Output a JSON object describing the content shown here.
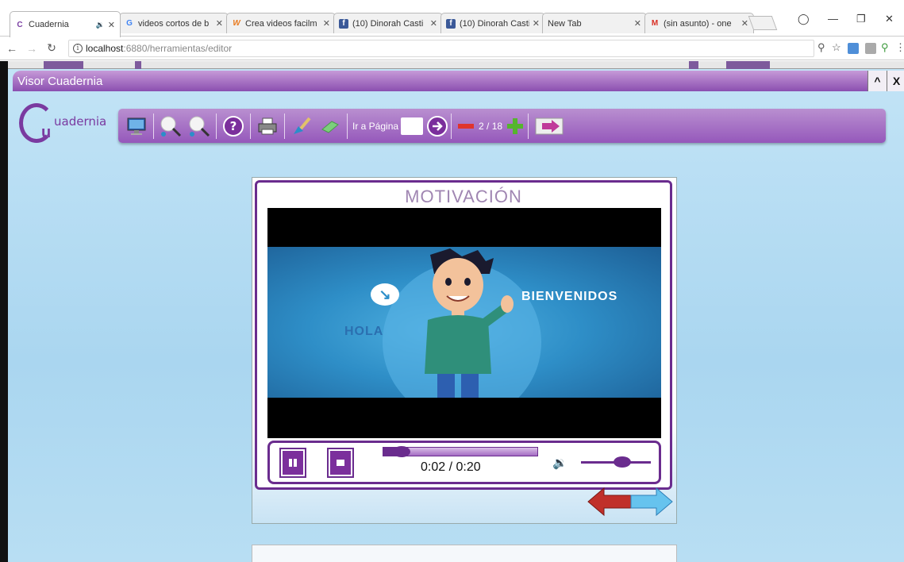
{
  "browser": {
    "tabs": [
      {
        "label": "Cuadernia",
        "icon": "cuadernia-icon",
        "audio": true,
        "active": true
      },
      {
        "label": "videos cortos de b",
        "icon": "google-icon"
      },
      {
        "label": "Crea videos facilm",
        "icon": "wideo-icon"
      },
      {
        "label": "(10) Dinorah Casti",
        "icon": "facebook-icon"
      },
      {
        "label": "(10) Dinorah Casti",
        "icon": "facebook-icon"
      },
      {
        "label": "New Tab",
        "icon": ""
      },
      {
        "label": "(sin asunto) - one",
        "icon": "gmail-icon"
      }
    ],
    "url_host": "localhost",
    "url_path": ":6880/herramientas/editor"
  },
  "visor": {
    "title": "Visor Cuadernia",
    "logo_text": "uadernia",
    "logo_letter": "u"
  },
  "toolbar": {
    "goto_label": "Ir a Página",
    "page_current": "2",
    "page_total": "18",
    "page_indicator": "2 / 18"
  },
  "slide": {
    "title": "MOTIVACIÓN",
    "video_text_left": "HOLA",
    "video_text_right": "BIENVENIDOS",
    "player_time": "0:02 / 0:20",
    "progress_fraction": 0.1,
    "volume_fraction": 0.45
  },
  "colors": {
    "accent": "#7b2f9c",
    "toolbar_purple": "#9558bb",
    "page_bg": "#aad6f0"
  }
}
